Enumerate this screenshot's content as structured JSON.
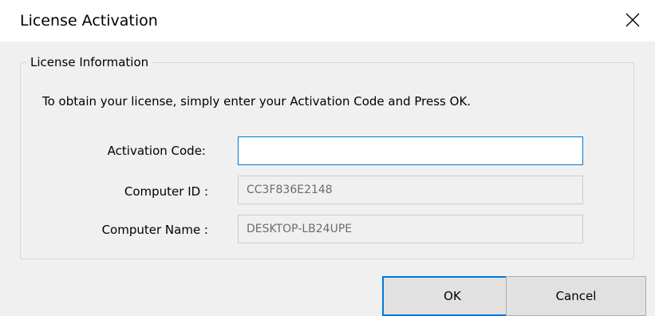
{
  "window": {
    "title": "License Activation",
    "close_icon": "close-icon"
  },
  "license_group": {
    "legend": "License Information",
    "instructions": "To obtain your license, simply enter your Activation Code and Press OK.",
    "activation_code": {
      "label": "Activation Code:",
      "value": ""
    },
    "computer_id": {
      "label": "Computer ID :",
      "value": "CC3F836E2148"
    },
    "computer_name": {
      "label": "Computer Name :",
      "value": "DESKTOP-LB24UPE"
    }
  },
  "buttons": {
    "ok_label": "OK",
    "cancel_label": "Cancel"
  },
  "colors": {
    "accent": "#0078d7",
    "dialog_background": "#f0f0f0",
    "title_background": "#ffffff",
    "readonly_text": "#6d6d6d"
  }
}
